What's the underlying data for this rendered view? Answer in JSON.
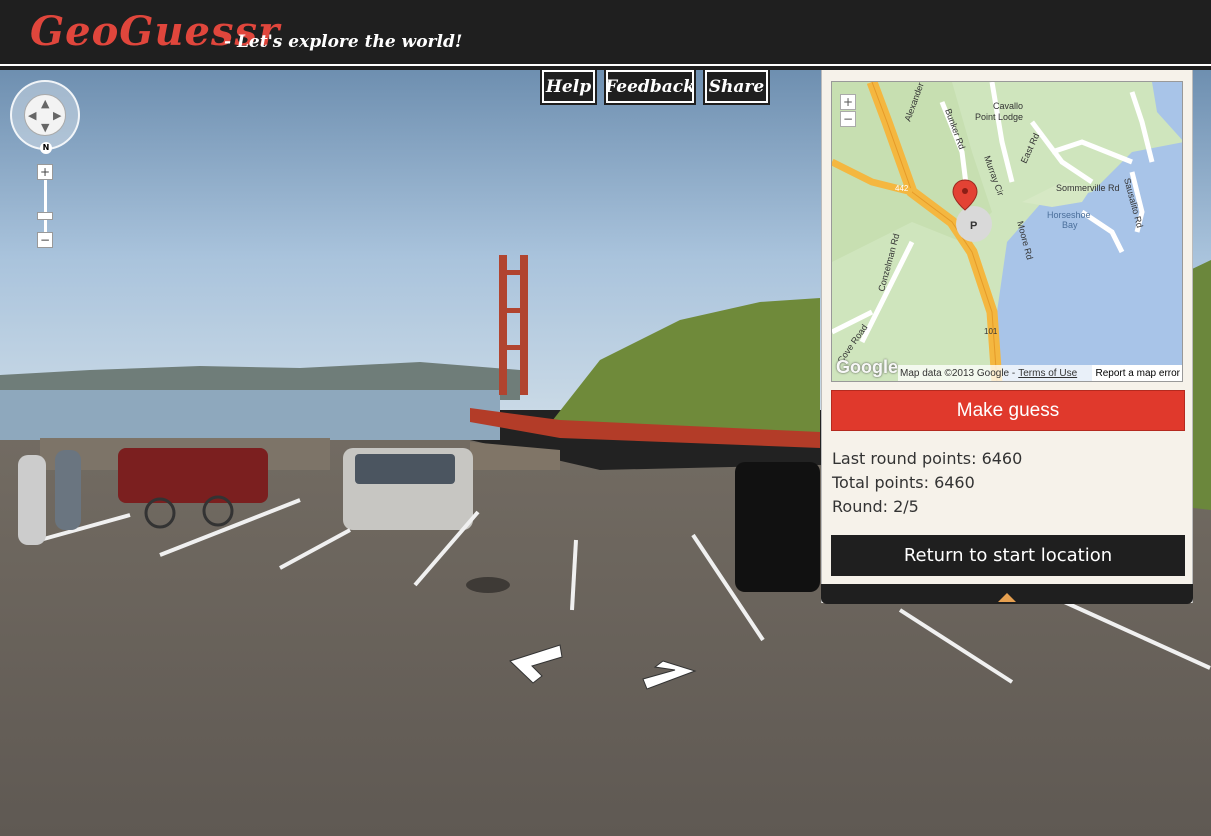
{
  "header": {
    "brand": "GeoGuessr",
    "tagline": "- Let's explore the world!"
  },
  "top_buttons": {
    "help": "Help",
    "feedback": "Feedback",
    "share": "Share"
  },
  "street_view": {
    "compass_label": "N",
    "zoom_in": "+",
    "zoom_out": "−",
    "pan_icon": "pan-control-icon",
    "nav_arrows": [
      "left-nav-arrow",
      "right-nav-arrow"
    ]
  },
  "mini_map": {
    "zoom_in": "+",
    "zoom_out": "−",
    "logo": "Google",
    "attribution": "Map data ©2013 Google -",
    "terms_link": "Terms of Use",
    "report_link": "Report a map error",
    "labels": {
      "cavallo": "Cavallo",
      "point_lodge": "Point Lodge",
      "alexander": "Alexander",
      "bunker": "Bunker Rd",
      "murray": "Murray Cir",
      "east": "East Rd",
      "sommerville": "Sommerville Rd",
      "sausalito": "Sausalito Rd",
      "horseshoe": "Horseshoe",
      "bay": "Bay",
      "conzelman": "Conzelman Rd",
      "moore": "Moore Rd",
      "parking": "P",
      "route_442": "442",
      "route_101": "101",
      "cove_road": "Cove Road"
    },
    "marker_icon": "map-pin-icon"
  },
  "guess_panel": {
    "make_guess": "Make guess",
    "last_round": "Last round points: 6460",
    "total": "Total points: 6460",
    "round": "Round: 2/5",
    "return": "Return to start location"
  },
  "colors": {
    "brand_red": "#e0463c",
    "guess_red": "#e0392c",
    "header_bg": "#1f1f1f",
    "panel_bg": "#f6f2ea",
    "road_orange": "#f4b740",
    "water": "#a8c4e8"
  }
}
